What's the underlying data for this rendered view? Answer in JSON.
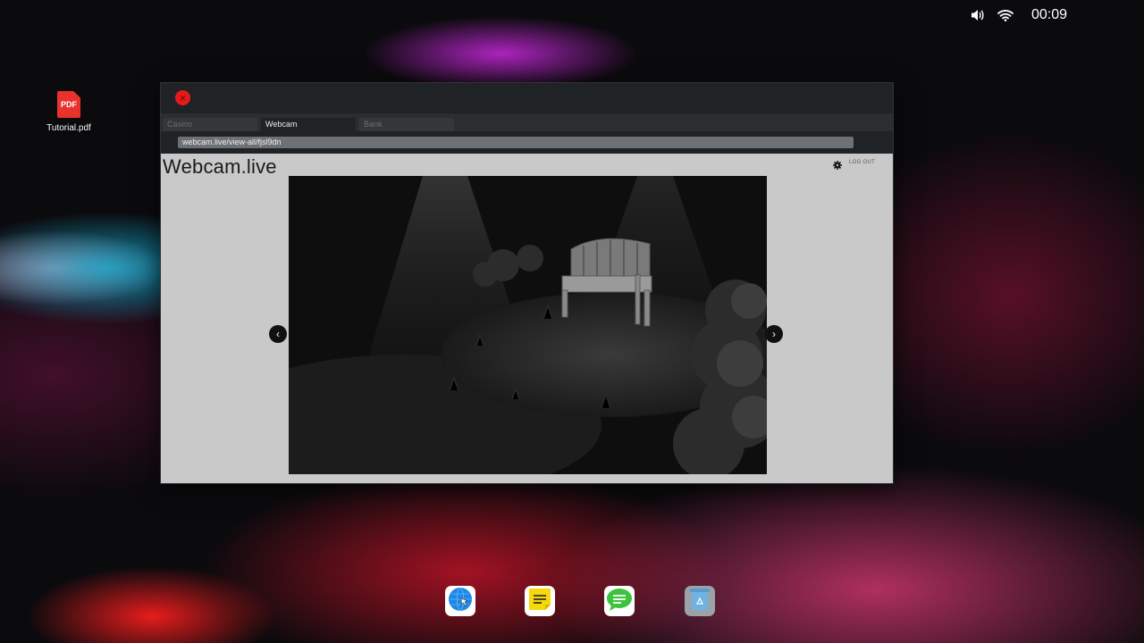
{
  "statusbar": {
    "volume_icon": "speaker-icon",
    "wifi_icon": "wifi-icon",
    "clock": "00:09"
  },
  "desktop": {
    "icons": [
      {
        "label": "Tutorial.pdf",
        "badge": "PDF",
        "icon": "pdf-file-icon"
      }
    ]
  },
  "browser": {
    "tabs": [
      {
        "label": "Casino",
        "active": false
      },
      {
        "label": "Webcam",
        "active": true
      },
      {
        "label": "Bank",
        "active": false
      }
    ],
    "url": "webcam.live/view-all/fjsl9dn"
  },
  "page": {
    "title": "Webcam.live",
    "logout_label": "LOG OUT",
    "prev_glyph": "‹",
    "next_glyph": "›"
  },
  "dock": {
    "items": [
      {
        "name": "browser",
        "icon": "browser-globe-icon"
      },
      {
        "name": "notes",
        "icon": "sticky-notes-icon"
      },
      {
        "name": "messages",
        "icon": "messages-icon"
      },
      {
        "name": "recycle-bin",
        "icon": "recycle-bin-icon"
      }
    ]
  },
  "colors": {
    "close_button": "#e31b1b",
    "page_background": "#c9c9c9",
    "notes_yellow": "#f5d90a",
    "messages_green": "#3cc43c",
    "browser_blue": "#1e88e5"
  }
}
